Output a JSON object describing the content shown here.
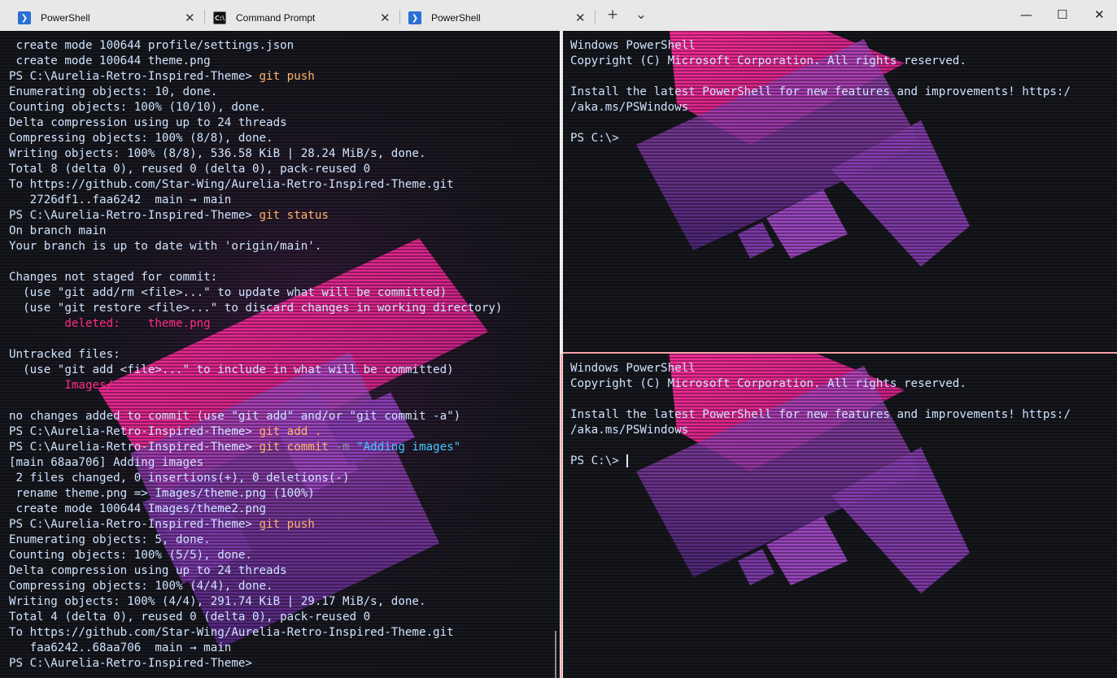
{
  "tabs": [
    {
      "label": "PowerShell",
      "icon": "powershell-icon"
    },
    {
      "label": "Command Prompt",
      "icon": "command-prompt-icon"
    },
    {
      "label": "PowerShell",
      "icon": "powershell-icon"
    }
  ],
  "icons": {
    "close": "✕",
    "new_tab": "+",
    "dropdown": "⌄",
    "minimize": "—",
    "maximize": "☐",
    "window_close": "✕",
    "ps_glyph": "❯",
    "cmd_glyph": "C:\\"
  },
  "colors": {
    "command": "#ffb36a",
    "string": "#42c9ff",
    "deleted": "#ff2d88",
    "text": "#cfe4ff",
    "accent_border": "#f2a2a8"
  },
  "left_pane": {
    "lines": [
      " create mode 100644 profile/settings.json",
      " create mode 100644 theme.png",
      [
        "PS C:\\Aurelia-Retro-Inspired-Theme> ",
        "git push"
      ],
      "Enumerating objects: 10, done.",
      "Counting objects: 100% (10/10), done.",
      "Delta compression using up to 24 threads",
      "Compressing objects: 100% (8/8), done.",
      "Writing objects: 100% (8/8), 536.58 KiB | 28.24 MiB/s, done.",
      "Total 8 (delta 0), reused 0 (delta 0), pack-reused 0",
      "To https://github.com/Star-Wing/Aurelia-Retro-Inspired-Theme.git",
      "   2726df1..faa6242  main → main",
      [
        "PS C:\\Aurelia-Retro-Inspired-Theme> ",
        "git status"
      ],
      "On branch main",
      "Your branch is up to date with 'origin/main'.",
      "",
      "Changes not staged for commit:",
      "  (use \"git add/rm <file>...\" to update what will be committed)",
      "  (use \"git restore <file>...\" to discard changes in working directory)",
      [
        "        ",
        "",
        "deleted:    theme.png"
      ],
      "",
      "Untracked files:",
      "  (use \"git add <file>...\" to include in what will be committed)",
      [
        "        ",
        "",
        "Images/"
      ],
      "",
      "no changes added to commit (use \"git add\" and/or \"git commit -a\")",
      [
        "PS C:\\Aurelia-Retro-Inspired-Theme> ",
        "git add ."
      ],
      [
        "PS C:\\Aurelia-Retro-Inspired-Theme> ",
        "git commit ",
        "-m ",
        "\"Adding images\""
      ],
      "[main 68aa706] Adding images",
      " 2 files changed, 0 insertions(+), 0 deletions(-)",
      " rename theme.png => Images/theme.png (100%)",
      " create mode 100644 Images/theme2.png",
      [
        "PS C:\\Aurelia-Retro-Inspired-Theme> ",
        "git push"
      ],
      "Enumerating objects: 5, done.",
      "Counting objects: 100% (5/5), done.",
      "Delta compression using up to 24 threads",
      "Compressing objects: 100% (4/4), done.",
      "Writing objects: 100% (4/4), 291.74 KiB | 29.17 MiB/s, done.",
      "Total 4 (delta 0), reused 0 (delta 0), pack-reused 0",
      "To https://github.com/Star-Wing/Aurelia-Retro-Inspired-Theme.git",
      "   faa6242..68aa706  main → main",
      [
        "PS C:\\Aurelia-Retro-Inspired-Theme> ",
        ""
      ]
    ]
  },
  "right_top_pane": {
    "lines": [
      "Windows PowerShell",
      "Copyright (C) Microsoft Corporation. All rights reserved.",
      "",
      "Install the latest PowerShell for new features and improvements! https:/",
      "/aka.ms/PSWindows",
      "",
      "PS C:\\>"
    ]
  },
  "right_bottom_pane": {
    "lines": [
      "Windows PowerShell",
      "Copyright (C) Microsoft Corporation. All rights reserved.",
      "",
      "Install the latest PowerShell for new features and improvements! https:/",
      "/aka.ms/PSWindows",
      "",
      "PS C:\\> "
    ]
  }
}
